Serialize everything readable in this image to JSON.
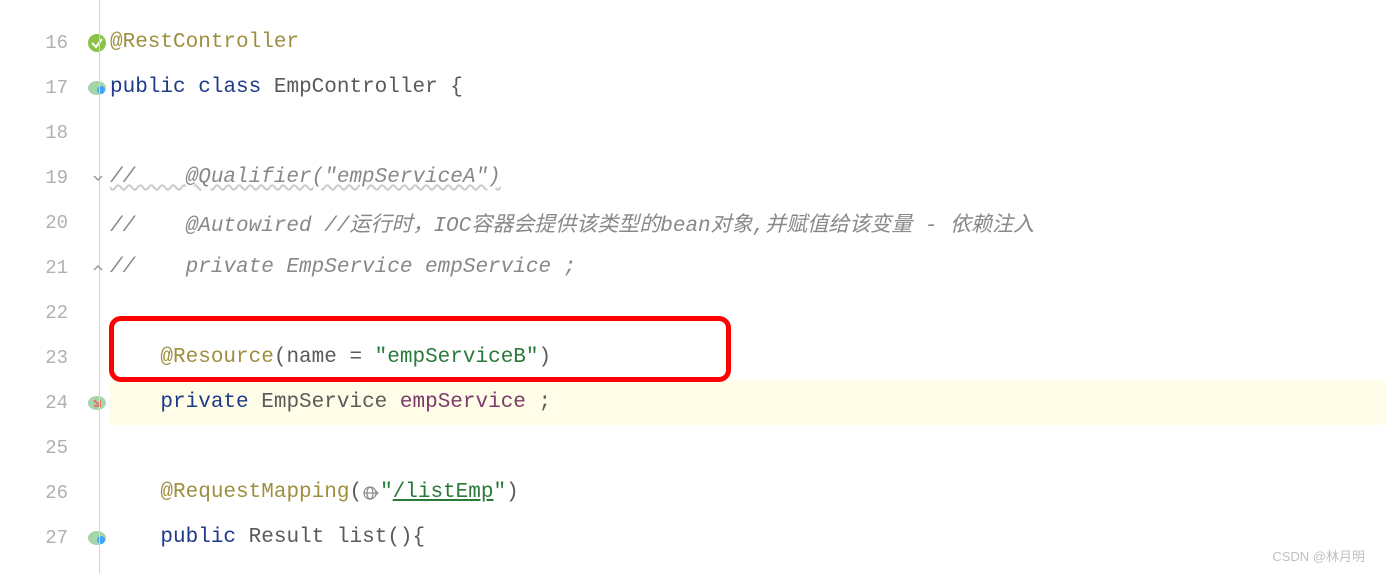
{
  "gutter": {
    "lines": [
      "16",
      "17",
      "18",
      "19",
      "20",
      "21",
      "22",
      "23",
      "24",
      "25",
      "26",
      "27"
    ]
  },
  "code": {
    "line16": {
      "annotation": "@RestController"
    },
    "line17": {
      "kw1": "public",
      "kw2": "class",
      "classname": "EmpController",
      "brace": " {"
    },
    "line18": "",
    "line19": {
      "comment": "//    @Qualifier(\"empServiceA\")"
    },
    "line20": {
      "comment": "//    @Autowired //运行时，IOC容器会提供该类型的bean对象,并赋值给该变量 - 依赖注入"
    },
    "line21": {
      "comment": "//    private EmpService empService ;"
    },
    "line22": "",
    "line23": {
      "annotation": "@Resource",
      "open": "(",
      "param": "name = ",
      "string": "\"empServiceB\"",
      "close": ")"
    },
    "line24": {
      "kw": "private",
      "type": "EmpService",
      "field": "empService",
      "semi": " ;"
    },
    "line25": "",
    "line26": {
      "annotation": "@RequestMapping",
      "open": "(",
      "string_open": "\"",
      "url": "/listEmp",
      "string_close": "\"",
      "close": ")"
    },
    "line27": {
      "kw": "public",
      "type": "Result",
      "method": "list",
      "parens": "(){"
    }
  },
  "watermark": "CSDN @林月明"
}
